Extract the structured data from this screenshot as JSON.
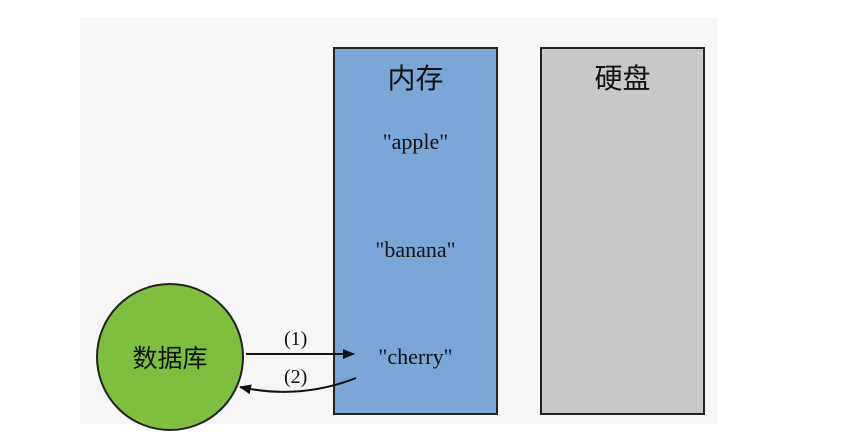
{
  "memory": {
    "title": "内存",
    "items": [
      "\"apple\"",
      "\"banana\"",
      "\"cherry\""
    ],
    "color": "#7aa7d8"
  },
  "disk": {
    "title": "硬盘",
    "color": "#c8c8c8"
  },
  "database": {
    "label": "数据库",
    "color": "#7fbf3f"
  },
  "steps": {
    "step1": "(1)",
    "step2": "(2)"
  }
}
